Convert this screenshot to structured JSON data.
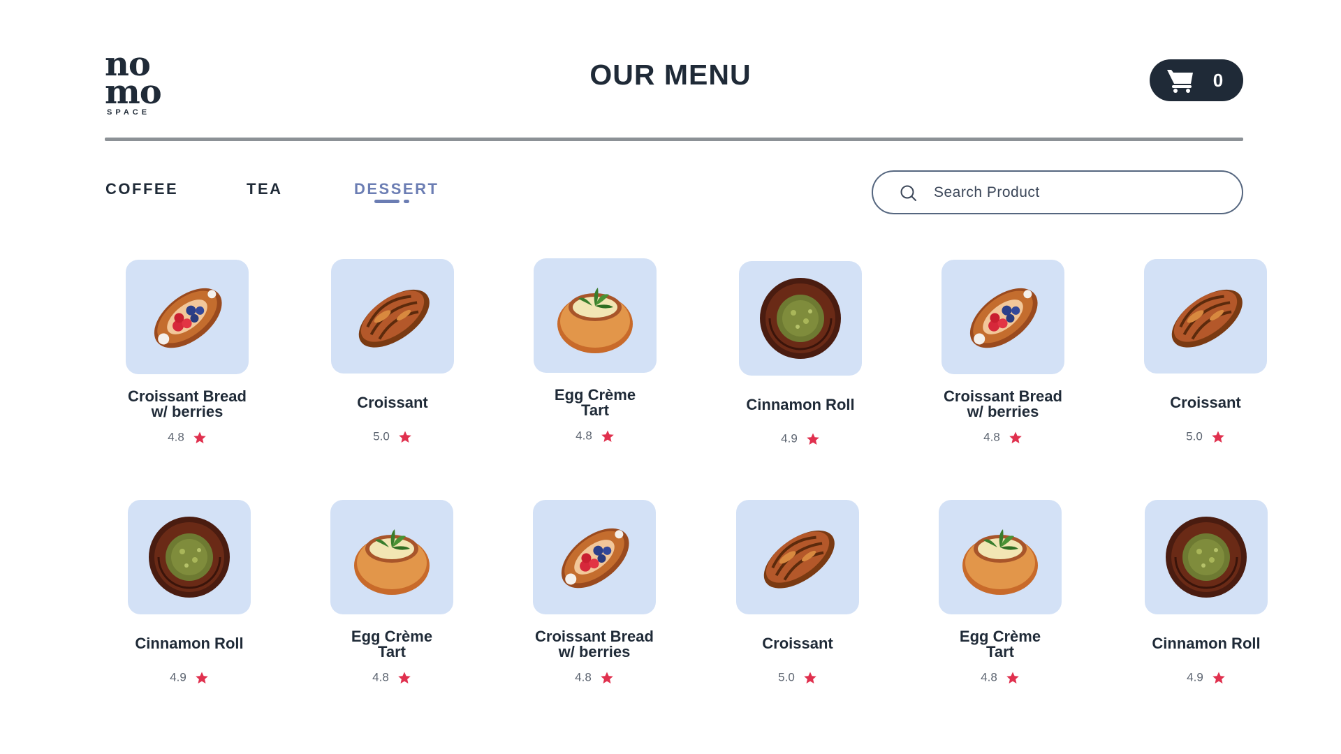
{
  "brand": {
    "logo_line1": "no",
    "logo_line2": "mo",
    "logo_sub": "SPACE"
  },
  "header": {
    "title": "OUR MENU",
    "cart_count": "0"
  },
  "tabs": [
    {
      "label": "COFFEE",
      "active": false
    },
    {
      "label": "TEA",
      "active": false
    },
    {
      "label": "DESSERT",
      "active": true
    }
  ],
  "search": {
    "placeholder": "Search Product",
    "value": ""
  },
  "colors": {
    "primary": "#1f2a37",
    "accent": "#6b7db3",
    "thumb_bg": "#d3e1f6",
    "star": "#e0304e",
    "divider": "#8c9196"
  },
  "products": [
    {
      "name_line1": "Croissant Bread",
      "name_line2": "w/ berries",
      "rating": "4.8",
      "image": "berry-danish"
    },
    {
      "name_line1": "Croissant",
      "name_line2": "",
      "rating": "5.0",
      "image": "croissant"
    },
    {
      "name_line1": "Egg Crème",
      "name_line2": "Tart",
      "rating": "4.8",
      "image": "egg-tart"
    },
    {
      "name_line1": "Cinnamon Roll",
      "name_line2": "",
      "rating": "4.9",
      "image": "cinnamon-roll"
    },
    {
      "name_line1": "Croissant Bread",
      "name_line2": "w/ berries",
      "rating": "4.8",
      "image": "berry-danish"
    },
    {
      "name_line1": "Croissant",
      "name_line2": "",
      "rating": "5.0",
      "image": "croissant"
    },
    {
      "name_line1": "Cinnamon Roll",
      "name_line2": "",
      "rating": "4.9",
      "image": "cinnamon-roll"
    },
    {
      "name_line1": "Egg Crème",
      "name_line2": "Tart",
      "rating": "4.8",
      "image": "egg-tart"
    },
    {
      "name_line1": "Croissant Bread",
      "name_line2": "w/ berries",
      "rating": "4.8",
      "image": "berry-danish"
    },
    {
      "name_line1": "Croissant",
      "name_line2": "",
      "rating": "5.0",
      "image": "croissant"
    },
    {
      "name_line1": "Egg Crème",
      "name_line2": "Tart",
      "rating": "4.8",
      "image": "egg-tart"
    },
    {
      "name_line1": "Cinnamon Roll",
      "name_line2": "",
      "rating": "4.9",
      "image": "cinnamon-roll"
    }
  ]
}
